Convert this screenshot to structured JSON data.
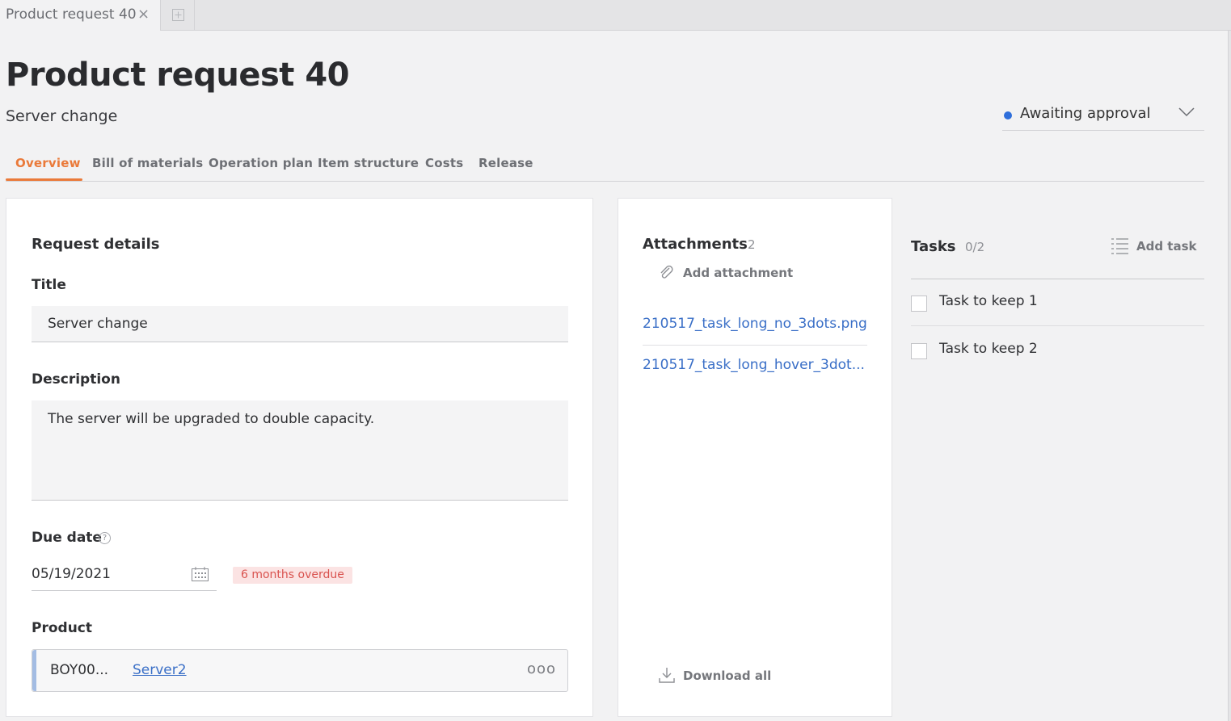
{
  "tabbar": {
    "doc_tab_label": "Product request 40",
    "close_glyph": "×"
  },
  "header": {
    "title": "Product request 40",
    "subtitle": "Server change",
    "status": {
      "label": "Awaiting approval",
      "dot_color": "#2f6fdb"
    }
  },
  "tabs": [
    {
      "label": "Overview",
      "active": true
    },
    {
      "label": "Bill of materials"
    },
    {
      "label": "Operation plan"
    },
    {
      "label": "Item structure"
    },
    {
      "label": "Costs"
    },
    {
      "label": "Release"
    }
  ],
  "request_details": {
    "heading": "Request details",
    "title_label": "Title",
    "title_value": "Server change",
    "description_label": "Description",
    "description_value": "The server will be upgraded to double capacity.",
    "due_date_label": "Due date",
    "due_date_help": "?",
    "due_date_value": "05/19/2021",
    "overdue_badge": "6 months overdue",
    "product_label": "Product",
    "product_code": "BOY00...",
    "product_link": "Server2",
    "product_more": "ooo"
  },
  "attachments": {
    "heading": "Attachments",
    "count": "2",
    "add_label": "Add attachment",
    "files": [
      "210517_task_long_no_3dots.png",
      "210517_task_long_hover_3dot..."
    ],
    "download_all": "Download all"
  },
  "tasks": {
    "heading": "Tasks",
    "count": "0/2",
    "add_label": "Add task",
    "items": [
      {
        "label": "Task to keep 1",
        "done": false
      },
      {
        "label": "Task to keep 2",
        "done": false
      }
    ]
  },
  "colors": {
    "accent": "#ea7a3a",
    "link": "#3a6fc7",
    "overdue_bg": "#fbe3e3",
    "overdue_text": "#d9534f"
  }
}
